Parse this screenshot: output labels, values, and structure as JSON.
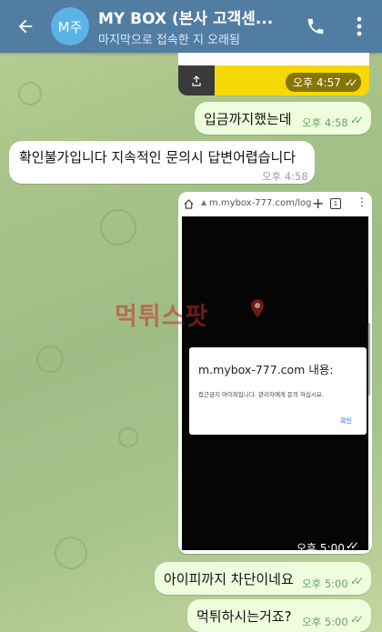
{
  "header": {
    "avatar_text": "M주",
    "title": "MY BOX (본사 고객센...",
    "status": "마지막으로 접속한 지 오래됨",
    "icons": [
      "back-arrow-icon",
      "phone-icon",
      "more-vert-icon"
    ],
    "color": "#527da3"
  },
  "messages": [
    {
      "type": "image",
      "direction": "out",
      "time": "오후 4:57"
    },
    {
      "type": "text",
      "direction": "out",
      "text": "입금까지했는데",
      "time": "오후 4:58"
    },
    {
      "type": "text",
      "direction": "in",
      "text": "확인불가입니다 지속적인 문의시 답변어렵습니다",
      "time": "오후 4:58"
    },
    {
      "type": "screenshot",
      "direction": "out",
      "time": "오후 5:00",
      "browser": {
        "url": "m.mybox-777.com/log",
        "tab_count": "1"
      },
      "dialog": {
        "title": "m.mybox-777.com 내용:",
        "message": "접근금지 아이피입니다. 관리자에게 문의 하십시요.",
        "ok": "확인"
      }
    },
    {
      "type": "text",
      "direction": "out",
      "text": "아이피까지 차단이네요",
      "time": "오후 5:00"
    },
    {
      "type": "text",
      "direction": "out",
      "text": "먹튀하시는거죠?",
      "time": "오후 5:00"
    }
  ],
  "watermark": "먹튀스팟",
  "colors": {
    "outgoing": "#effdde",
    "incoming": "#ffffff",
    "check": "#5ea854"
  }
}
